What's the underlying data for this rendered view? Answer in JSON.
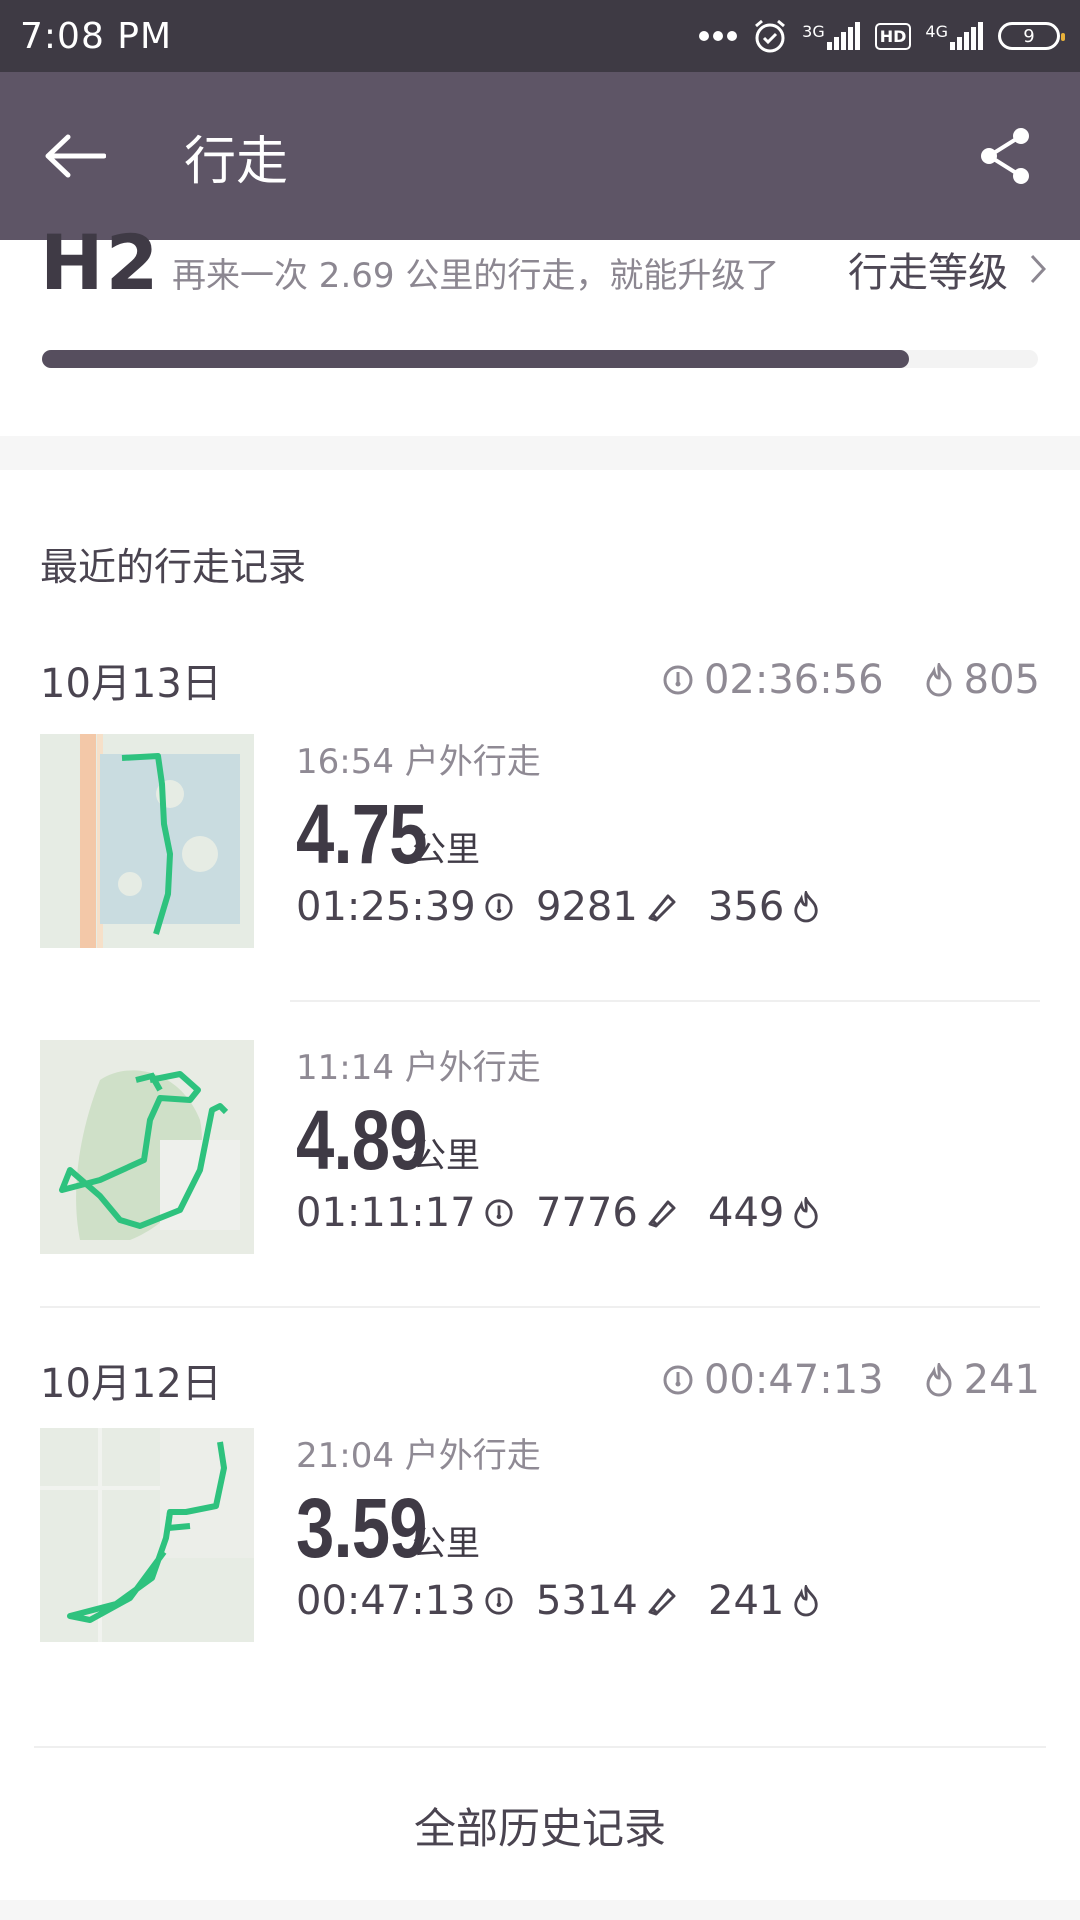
{
  "status_bar": {
    "time": "7:08  PM",
    "network_1": "3G",
    "hd_label": "HD",
    "network_2": "4G",
    "battery": "9"
  },
  "app_bar": {
    "title": "行走",
    "back_icon": "arrow-left-icon",
    "share_icon": "share-icon"
  },
  "level": {
    "code": "H2",
    "hint": "再来一次 2.69 公里的行走，就能升级了",
    "link_label": "行走等级",
    "progress_percent": 87
  },
  "records": {
    "section_title": "最近的行走记录",
    "days": [
      {
        "date": "10月13日",
        "total_time": "02:36:56",
        "total_calories": "805",
        "items": [
          {
            "subtitle": "16:54 户外行走",
            "distance": "4.75",
            "unit": "公里",
            "duration": "01:25:39",
            "steps": "9281",
            "calories": "356"
          },
          {
            "subtitle": "11:14 户外行走",
            "distance": "4.89",
            "unit": "公里",
            "duration": "01:11:17",
            "steps": "7776",
            "calories": "449"
          }
        ]
      },
      {
        "date": "10月12日",
        "total_time": "00:47:13",
        "total_calories": "241",
        "items": [
          {
            "subtitle": "21:04 户外行走",
            "distance": "3.59",
            "unit": "公里",
            "duration": "00:47:13",
            "steps": "5314",
            "calories": "241"
          }
        ]
      }
    ]
  },
  "history_button": "全部历史记录",
  "colors": {
    "status_bar": "#3e3a44",
    "app_bar": "#5e5566",
    "progress": "#564e5e",
    "route": "#2ec27e"
  }
}
